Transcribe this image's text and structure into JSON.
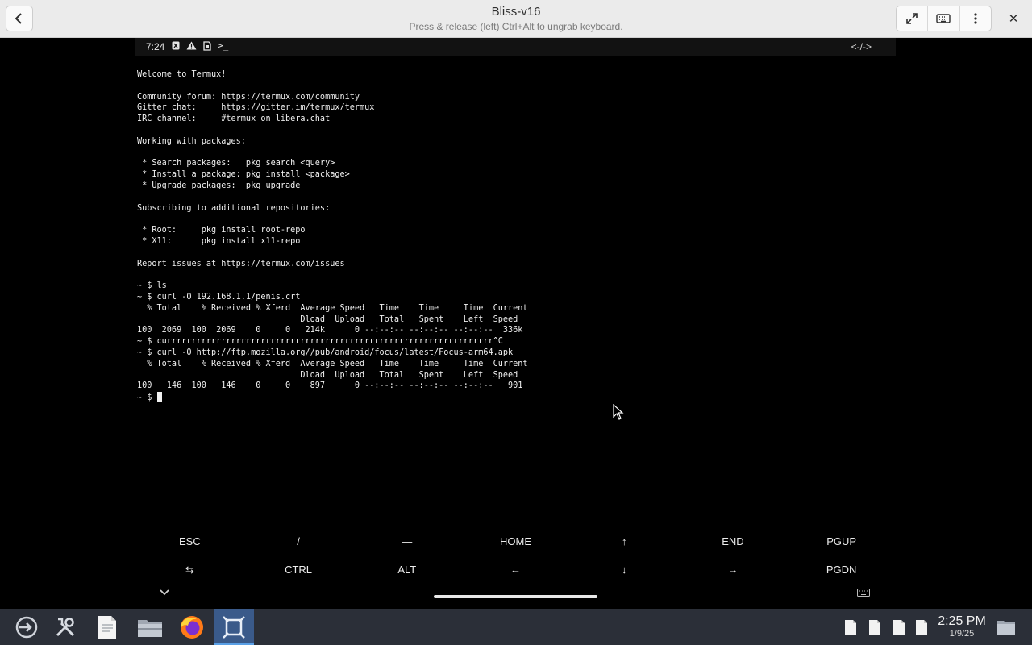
{
  "window": {
    "title": "Bliss-v16",
    "subtitle": "Press & release (left) Ctrl+Alt to ungrab keyboard."
  },
  "statusbar": {
    "time": "7:24",
    "icons": [
      "notification-icon",
      "warning-icon",
      "sim-icon",
      "terminal-icon"
    ],
    "right_icon": "<-/->"
  },
  "terminal": {
    "lines": [
      "Welcome to Termux!",
      "",
      "Community forum: https://termux.com/community",
      "Gitter chat:     https://gitter.im/termux/termux",
      "IRC channel:     #termux on libera.chat",
      "",
      "Working with packages:",
      "",
      " * Search packages:   pkg search <query>",
      " * Install a package: pkg install <package>",
      " * Upgrade packages:  pkg upgrade",
      "",
      "Subscribing to additional repositories:",
      "",
      " * Root:     pkg install root-repo",
      " * X11:      pkg install x11-repo",
      "",
      "Report issues at https://termux.com/issues",
      "",
      "~ $ ls",
      "~ $ curl -O 192.168.1.1/penis.crt",
      "  % Total    % Received % Xferd  Average Speed   Time    Time     Time  Current",
      "                                 Dload  Upload   Total   Spent    Left  Speed",
      "100  2069  100  2069    0     0   214k      0 --:--:-- --:--:-- --:--:--  336k",
      "~ $ currrrrrrrrrrrrrrrrrrrrrrrrrrrrrrrrrrrrrrrrrrrrrrrrrrrrrrrrrrrrrrrrr^C",
      "~ $ curl -O http://ftp.mozilla.org//pub/android/focus/latest/Focus-arm64.apk",
      "  % Total    % Received % Xferd  Average Speed   Time    Time     Time  Current",
      "                                 Dload  Upload   Total   Spent    Left  Speed",
      "100   146  100   146    0     0    897      0 --:--:-- --:--:-- --:--:--   901",
      "~ $ "
    ]
  },
  "extra_keys": {
    "row1": [
      "ESC",
      "/",
      "—",
      "HOME",
      "↑",
      "END",
      "PGUP"
    ],
    "row2": [
      "⇆",
      "CTRL",
      "ALT",
      "←",
      "↓",
      "→",
      "PGDN"
    ]
  },
  "taskbar": {
    "apps": [
      "start-menu-icon",
      "settings-tools-icon",
      "text-editor-icon",
      "file-manager-icon",
      "firefox-icon",
      "bliss-vm-icon"
    ],
    "tray": [
      "doc-icon",
      "doc-icon",
      "doc-icon",
      "doc-icon",
      "folder-icon"
    ],
    "time": "2:25 PM",
    "date": "1/9/25"
  },
  "colors": {
    "titlebar_bg": "#ebebeb",
    "taskbar_bg": "#2b2f38",
    "active_task": "#3a5a8a",
    "terminal_fg": "#f0f0f0"
  }
}
